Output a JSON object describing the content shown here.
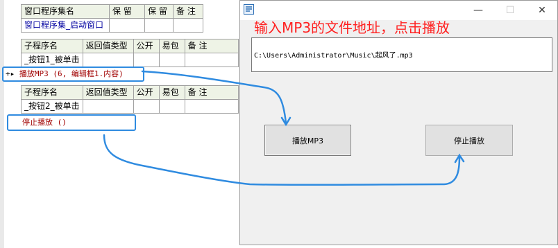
{
  "window_table": {
    "headers": [
      "窗口程序集名",
      "保 留",
      "保 留",
      "备 注"
    ],
    "row": [
      "窗口程序集_启动窗口",
      "",
      "",
      ""
    ]
  },
  "sub1": {
    "headers": [
      "子程序名",
      "返回值类型",
      "公开",
      "易包",
      "备 注"
    ],
    "row": [
      "_按钮1_被单击",
      "",
      "",
      "",
      ""
    ]
  },
  "code1": {
    "prefix": "+▸",
    "statement": "播放MP3 (6, 编辑框1.内容)"
  },
  "sub2": {
    "headers": [
      "子程序名",
      "返回值类型",
      "公开",
      "易包",
      "备 注"
    ],
    "row": [
      "_按钮2_被单击",
      "",
      "",
      "",
      ""
    ]
  },
  "code2": {
    "statement": "停止播放 ()"
  },
  "app_window": {
    "minimize_glyph": "—",
    "maximize_glyph": "☐",
    "close_glyph": "✕",
    "hint": "输入MP3的文件地址，点击播放",
    "path_value": "C:\\Users\\Administrator\\Music\\起风了.mp3",
    "play_button": "播放MP3",
    "stop_button": "停止播放"
  },
  "colors": {
    "hint": "#ff2020",
    "highlight": "#2f8be0",
    "code_red": "#a00000",
    "header_bg": "#eef3e6"
  }
}
